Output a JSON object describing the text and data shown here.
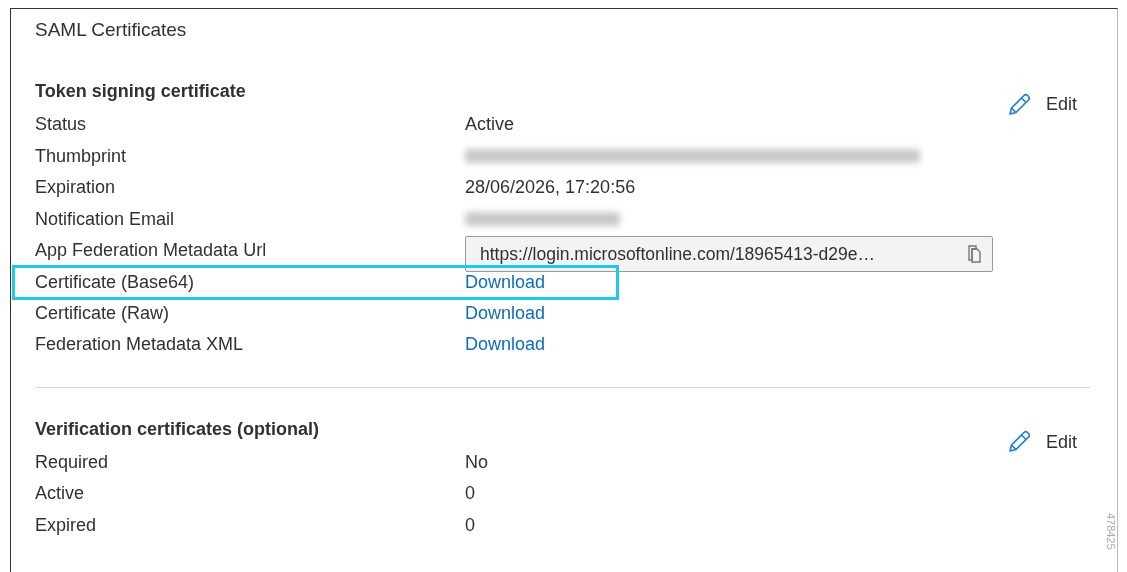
{
  "panel": {
    "title": "SAML Certificates"
  },
  "sections": [
    {
      "heading": "Token signing certificate",
      "edit": "Edit",
      "rows": [
        {
          "label": "Status",
          "kind": "text",
          "value": "Active",
          "highlighted": false
        },
        {
          "label": "Thumbprint",
          "kind": "redacted",
          "highlighted": false
        },
        {
          "label": "Expiration",
          "kind": "text",
          "value": "28/06/2026, 17:20:56",
          "highlighted": false
        },
        {
          "label": "Notification Email",
          "kind": "redacted",
          "highlighted": false
        },
        {
          "label": "App Federation Metadata Url",
          "kind": "field",
          "value": "https://login.microsoftonline.com/18965413-d29e…",
          "highlighted": false
        },
        {
          "label": "Certificate (Base64)",
          "kind": "link",
          "value": "Download",
          "highlighted": true
        },
        {
          "label": "Certificate (Raw)",
          "kind": "link",
          "value": "Download",
          "highlighted": false
        },
        {
          "label": "Federation Metadata XML",
          "kind": "link",
          "value": "Download",
          "highlighted": false
        }
      ]
    },
    {
      "heading": "Verification certificates (optional)",
      "edit": "Edit",
      "rows": [
        {
          "label": "Required",
          "kind": "text",
          "value": "No",
          "highlighted": false
        },
        {
          "label": "Active",
          "kind": "text",
          "value": "0",
          "highlighted": false
        },
        {
          "label": "Expired",
          "kind": "text",
          "value": "0",
          "highlighted": false
        }
      ]
    }
  ],
  "figure_number": "478425"
}
